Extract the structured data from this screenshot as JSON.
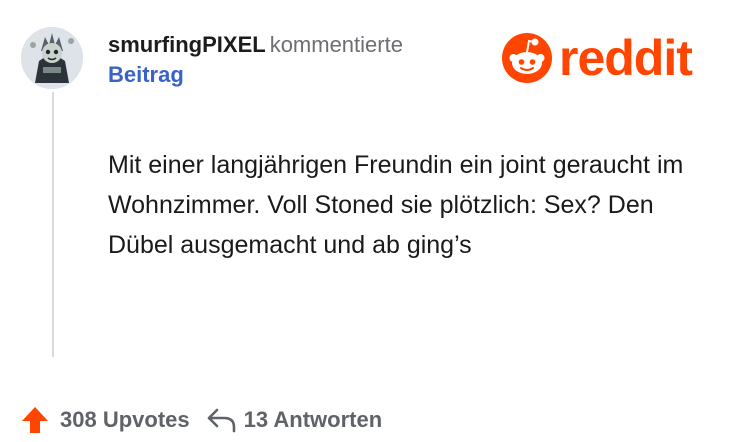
{
  "comment": {
    "username": "smurfingPIXEL",
    "action": "kommentierte",
    "target": "Beitrag",
    "text": "Mit einer langjährigen Freundin ein joint geraucht im Wohnzimmer. Voll Stoned sie plötzlich: Sex? Den Dübel ausgemacht und ab ging’s"
  },
  "brand": {
    "wordmark": "reddit",
    "color": "#ff4500"
  },
  "footer": {
    "upvotes_label": "308 Upvotes",
    "replies_label": "13 Antworten"
  },
  "icons": {
    "avatar": "avatar-image",
    "logo": "reddit-snoo-icon",
    "upvote": "upvote-arrow-icon",
    "reply": "reply-arrow-icon"
  },
  "colors": {
    "username": "#1c1c1c",
    "action": "#6b6e72",
    "target_link": "#3a63c9",
    "upvote": "#ff4500",
    "footer_text": "#5f6368"
  }
}
